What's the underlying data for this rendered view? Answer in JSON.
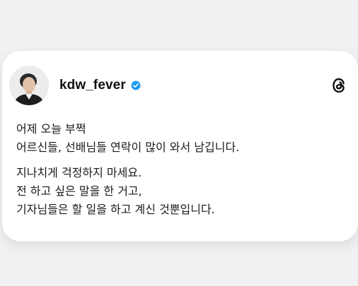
{
  "post": {
    "username": "kdw_fever",
    "verified_icon": "verified-badge-icon",
    "brand_icon": "threads-logo-icon",
    "accent_color": "#1d9bf0",
    "paragraphs": [
      [
        "어제 오늘 부쩍",
        "어르신들, 선배님들 연락이 많이 와서 남깁니다."
      ],
      [
        "지나치게 걱정하지 마세요.",
        "전 하고 싶은 말을 한 거고,",
        "기자님들은 할 일을 하고 계신 것뿐입니다."
      ]
    ]
  }
}
